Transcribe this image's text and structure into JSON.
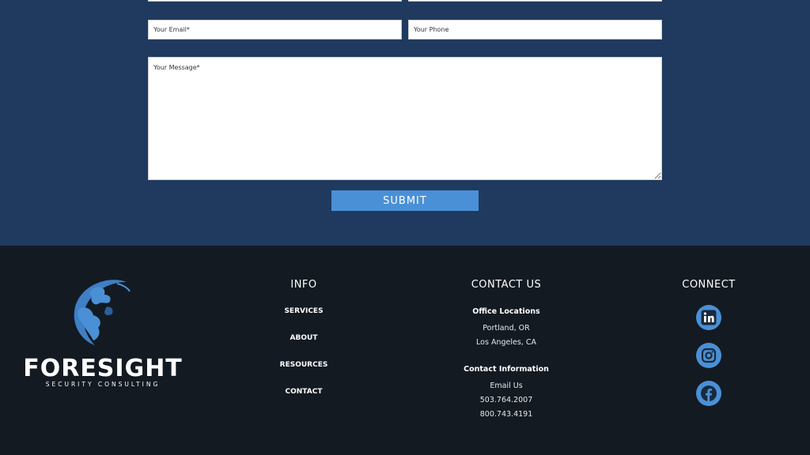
{
  "form": {
    "email_placeholder": "Your Email*",
    "phone_placeholder": "Your Phone",
    "message_placeholder": "Your Message*",
    "submit_label": "SUBMIT"
  },
  "footer": {
    "logo": {
      "word": "FORESIGHT",
      "sub": "SECURITY CONSULTING"
    },
    "info": {
      "title": "INFO",
      "links": [
        "SERVICES",
        "ABOUT",
        "RESOURCES",
        "CONTACT"
      ]
    },
    "contact": {
      "title": "CONTACT US",
      "office_heading": "Office Locations",
      "office_lines": [
        "Portland, OR",
        "Los Angeles, CA"
      ],
      "info_heading": "Contact Information",
      "info_lines": [
        "Email Us",
        "503.764.2007",
        "800.743.4191"
      ]
    },
    "connect": {
      "title": "CONNECT",
      "icons": [
        "linkedin-icon",
        "instagram-icon",
        "facebook-icon"
      ]
    }
  },
  "colors": {
    "form_bg": "#1f3a5e",
    "footer_bg": "#131a22",
    "accent": "#4a90d6"
  }
}
